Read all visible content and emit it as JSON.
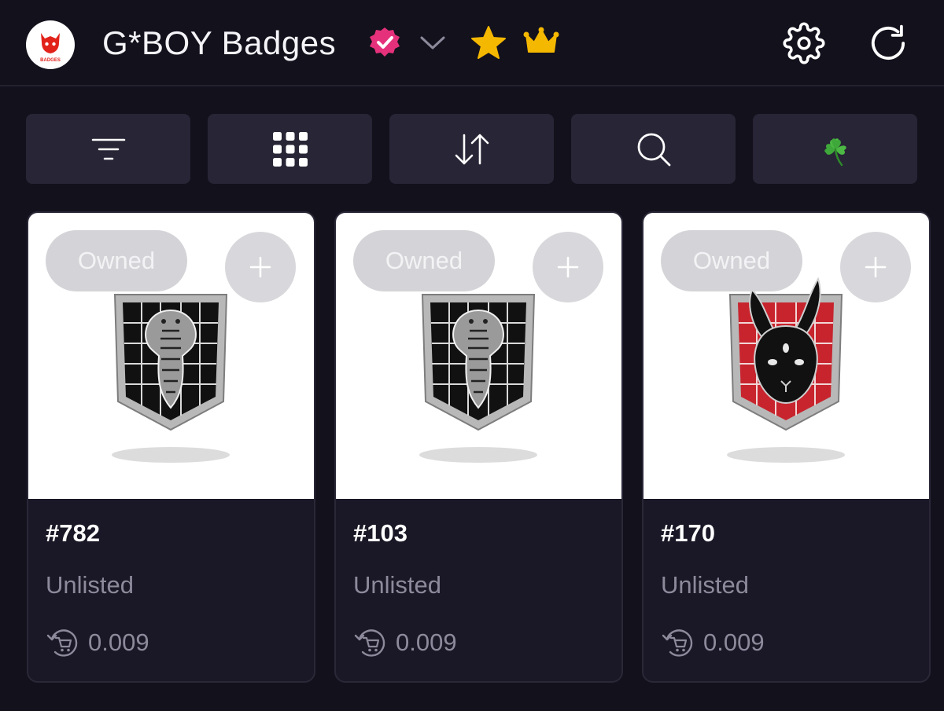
{
  "header": {
    "logo_text": "BADGES",
    "title": "G*BOY Badges",
    "icons": [
      "verified-icon",
      "chevron-down-icon",
      "star-icon",
      "crown-icon",
      "settings-icon",
      "refresh-icon"
    ]
  },
  "toolbar": {
    "buttons": [
      "filter-icon",
      "grid-view-icon",
      "sort-icon",
      "search-icon",
      "clover-icon"
    ]
  },
  "colors": {
    "background": "#13111c",
    "card": "#1a1826",
    "button": "#282536",
    "verified": "#e5317b",
    "gold": "#f5b800",
    "muted_text": "#8d8a9c"
  },
  "cards": [
    {
      "owned_label": "Owned",
      "id": "#782",
      "status": "Unlisted",
      "price": "0.009",
      "badge": "cobra"
    },
    {
      "owned_label": "Owned",
      "id": "#103",
      "status": "Unlisted",
      "price": "0.009",
      "badge": "cobra"
    },
    {
      "owned_label": "Owned",
      "id": "#170",
      "status": "Unlisted",
      "price": "0.009",
      "badge": "rabbit"
    }
  ]
}
